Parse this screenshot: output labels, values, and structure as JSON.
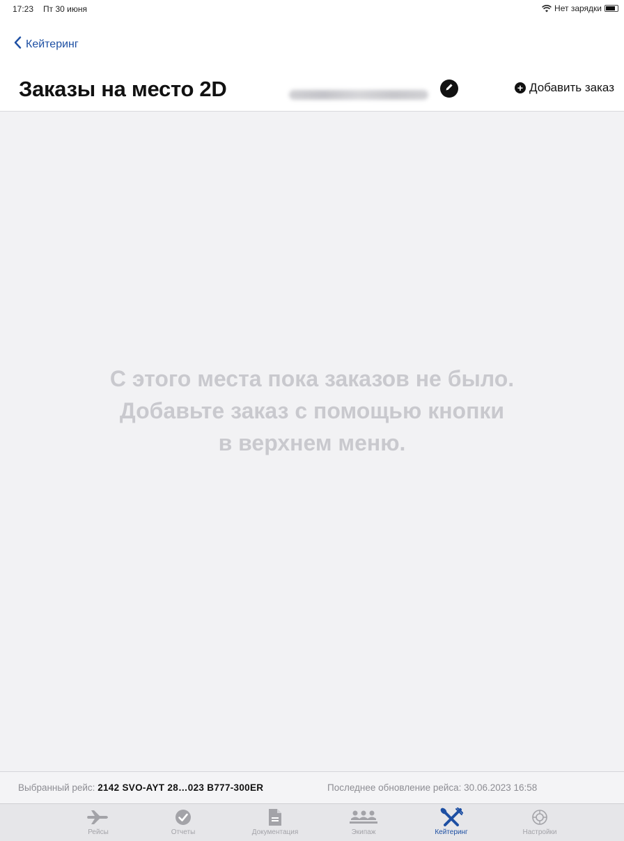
{
  "status_bar": {
    "time": "17:23",
    "date": "Пт 30 июня",
    "charging": "Нет зарядки"
  },
  "nav": {
    "back_label": "Кейтеринг",
    "title": "Заказы на место 2D",
    "add_order_label": "Добавить заказ"
  },
  "empty_state": {
    "line1": "С этого места пока заказов не было.",
    "line2": "Добавьте заказ с помощью кнопки",
    "line3": "в верхнем меню."
  },
  "footer": {
    "selected_flight_label": "Выбранный рейс:",
    "selected_flight_value": "2142 SVO-AYT 28…023 B777-300ER",
    "last_update": "Последнее обновление рейса: 30.06.2023 16:58"
  },
  "tabs": [
    {
      "label": "Рейсы",
      "icon": "airplane-icon",
      "active": false
    },
    {
      "label": "Отчеты",
      "icon": "checkmark-circle-icon",
      "active": false
    },
    {
      "label": "Документация",
      "icon": "document-icon",
      "active": false
    },
    {
      "label": "Экипаж",
      "icon": "crew-icon",
      "active": false
    },
    {
      "label": "Кейтеринг",
      "icon": "catering-icon",
      "active": true
    },
    {
      "label": "Настройки",
      "icon": "settings-icon",
      "active": false
    }
  ],
  "colors": {
    "accent": "#1d4fa3",
    "empty_text": "#c9c9ce",
    "inactive_tab": "#a3a3a8"
  }
}
